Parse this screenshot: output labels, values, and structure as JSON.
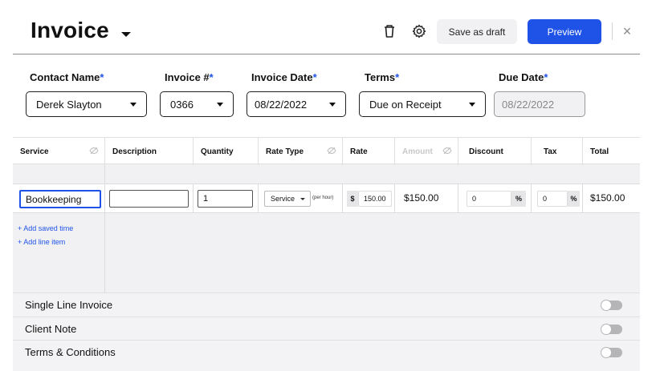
{
  "header": {
    "title": "Invoice",
    "save_draft_label": "Save as draft",
    "preview_label": "Preview",
    "close_glyph": "×"
  },
  "fields": {
    "contact_name": {
      "label": "Contact Name",
      "value": "Derek Slayton"
    },
    "invoice_number": {
      "label": "Invoice #",
      "value": "0366"
    },
    "invoice_date": {
      "label": "Invoice Date",
      "value": "08/22/2022"
    },
    "terms": {
      "label": "Terms",
      "value": "Due on Receipt"
    },
    "due_date": {
      "label": "Due Date",
      "value": "08/22/2022"
    },
    "required_mark": "*"
  },
  "table": {
    "headers": {
      "service": "Service",
      "description": "Description",
      "quantity": "Quantity",
      "rate_type": "Rate Type",
      "rate": "Rate",
      "amount": "Amount",
      "discount": "Discount",
      "tax": "Tax",
      "total": "Total"
    },
    "row": {
      "service": "Bookkeeping",
      "description": "",
      "quantity": "1",
      "rate_type": "Service",
      "rate_type_note": "(per hour)",
      "rate_currency": "$",
      "rate": "150.00",
      "amount": "$150.00",
      "discount": "0",
      "discount_unit": "%",
      "tax": "0",
      "tax_unit": "%",
      "total": "$150.00"
    },
    "add_saved_time": "+ Add saved time",
    "add_line_item": "+ Add line item"
  },
  "options": [
    {
      "label": "Single Line Invoice",
      "enabled": false
    },
    {
      "label": "Client Note",
      "enabled": false
    },
    {
      "label": "Terms & Conditions",
      "enabled": false
    }
  ],
  "colors": {
    "accent": "#1f53e8",
    "panel": "#f1f1f3"
  }
}
